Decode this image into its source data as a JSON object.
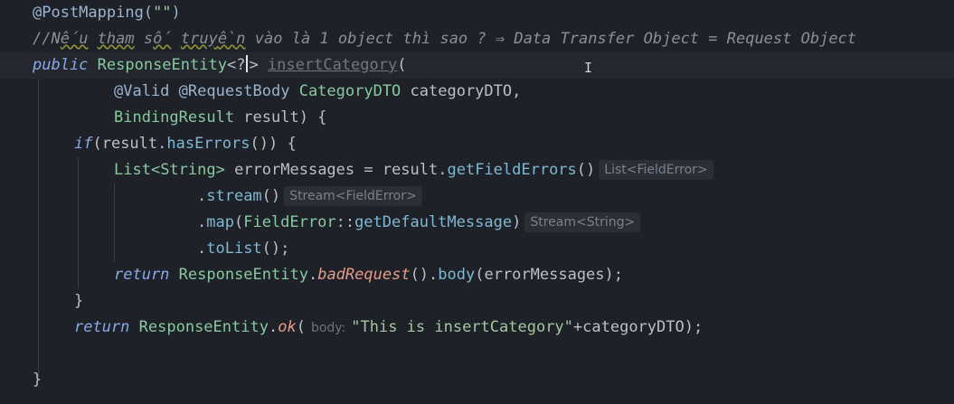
{
  "code": {
    "l1": {
      "annotation": "@PostMapping(",
      "str": "\"\"",
      "close": ")"
    },
    "l2": {
      "c1": "//N",
      "c2": "ếu",
      "c3": " ",
      "c4": "tham",
      "c5": " s",
      "c6": "ố",
      "c7": " ",
      "c8": "truy",
      "c9": "ền",
      "c10": " vào là 1 object thì sao ? ⇒ Data Transfer Object = Request Object"
    },
    "l3": {
      "kw": "public ",
      "type": "ResponseEntity",
      "generic_a": "<?",
      "generic_b": ">",
      "space": " ",
      "method": "insertCategory",
      "open": "("
    },
    "l4": {
      "ann": "@Valid @RequestBody ",
      "type": "CategoryDTO",
      "param": " categoryDTO,"
    },
    "l5": {
      "type": "BindingResult",
      "rest": " result) {"
    },
    "l6": {
      "kw": "if",
      "a": "(result.",
      "method": "hasErrors",
      "b": "()) {"
    },
    "l7": {
      "type": "List",
      "gen": "<String>",
      "a": " errorMessages = result.",
      "method": "getFieldErrors",
      "b": "()",
      "hint": "List<FieldError>"
    },
    "l8": {
      "a": ".",
      "method": "stream",
      "b": "()",
      "hint": "Stream<FieldError>"
    },
    "l9": {
      "a": ".",
      "method": "map",
      "b": "(",
      "type": "FieldError",
      "sep": "::",
      "ref": "getDefaultMessage",
      "c": ")",
      "hint": "Stream<String>"
    },
    "l10": {
      "a": ".",
      "method": "toList",
      "b": "();"
    },
    "l11": {
      "kw": "return ",
      "type": "ResponseEntity",
      "a": ".",
      "stat": "badRequest",
      "b": "().",
      "method": "body",
      "c": "(errorMessages);"
    },
    "l12": {
      "brace": "}"
    },
    "l13": {
      "kw": "return ",
      "type": "ResponseEntity",
      "a": ".",
      "stat": "ok",
      "b": "(",
      "label": "body:",
      "str": "\"This is insertCategory\"",
      "c": "+categoryDTO);"
    },
    "l14": {
      "brace": "}"
    }
  },
  "colors": {
    "background": "#1e2127",
    "keyword": "#8aa8e6",
    "type": "#88c9a0",
    "method": "#7fb8d2",
    "string": "#a5c6a0",
    "static_call": "#e49b8a",
    "comment": "#8a8f99"
  },
  "icons": {
    "mouse_cursor": "i-beam-cursor-icon"
  }
}
